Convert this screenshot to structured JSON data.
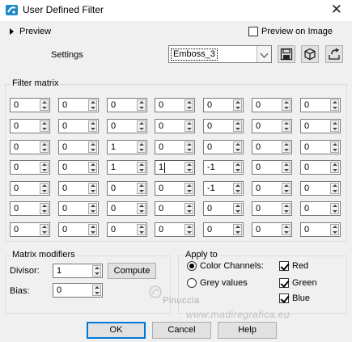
{
  "window": {
    "title": "User Defined Filter",
    "close_glyph": "✕",
    "icon": "app-icon"
  },
  "top": {
    "preview_label": "Preview",
    "preview_on_image_label": "Preview on Image",
    "preview_on_image_checked": false,
    "settings_label": "Settings",
    "preset_value": "Emboss_3",
    "tool_icons": [
      "save-icon",
      "cube-icon",
      "reset-icon"
    ]
  },
  "filter_matrix": {
    "label": "Filter matrix",
    "rows": [
      [
        "0",
        "0",
        "0",
        "0",
        "0",
        "0",
        "0"
      ],
      [
        "0",
        "0",
        "0",
        "0",
        "0",
        "0",
        "0"
      ],
      [
        "0",
        "0",
        "1",
        "0",
        "0",
        "0",
        "0"
      ],
      [
        "0",
        "0",
        "1",
        "1",
        "-1",
        "0",
        "0"
      ],
      [
        "0",
        "0",
        "0",
        "0",
        "-1",
        "0",
        "0"
      ],
      [
        "0",
        "0",
        "0",
        "0",
        "0",
        "0",
        "0"
      ],
      [
        "0",
        "0",
        "0",
        "0",
        "0",
        "0",
        "0"
      ]
    ]
  },
  "matrix_modifiers": {
    "label": "Matrix modifiers",
    "divisor_label": "Divisor:",
    "divisor_value": "1",
    "compute_label": "Compute",
    "bias_label": "Bias:",
    "bias_value": "0"
  },
  "apply_to": {
    "label": "Apply to",
    "color_channels_label": "Color Channels:",
    "grey_values_label": "Grey values",
    "mode": "color",
    "red_label": "Red",
    "green_label": "Green",
    "blue_label": "Blue",
    "red": true,
    "green": true,
    "blue": true
  },
  "watermark": {
    "line1": "Pinuccia",
    "line2": "www.madiregrafica.eu"
  },
  "buttons": {
    "ok": "OK",
    "cancel": "Cancel",
    "help": "Help"
  }
}
